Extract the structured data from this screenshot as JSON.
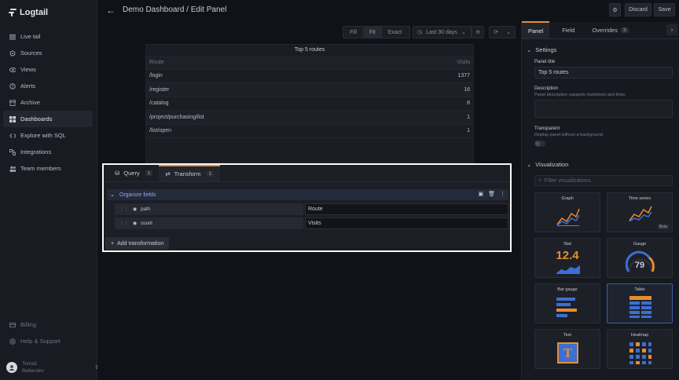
{
  "app": {
    "name": "Logtail"
  },
  "sidebar": {
    "items": [
      {
        "label": "Live tail",
        "icon": "list-icon"
      },
      {
        "label": "Sources",
        "icon": "sources-icon"
      },
      {
        "label": "Views",
        "icon": "eye-icon"
      },
      {
        "label": "Alerts",
        "icon": "alert-icon"
      },
      {
        "label": "Archive",
        "icon": "archive-icon"
      },
      {
        "label": "Dashboards",
        "icon": "dashboard-icon",
        "active": true
      },
      {
        "label": "Explore with SQL",
        "icon": "code-icon"
      },
      {
        "label": "Integrations",
        "icon": "integrations-icon"
      },
      {
        "label": "Team members",
        "icon": "team-icon"
      }
    ],
    "bottom": [
      {
        "label": "Billing",
        "icon": "billing-icon"
      },
      {
        "label": "Help & Support",
        "icon": "help-icon"
      }
    ],
    "user": {
      "name": "Tomáš",
      "team": "Betterdev"
    }
  },
  "header": {
    "title": "Demo Dashboard / Edit Panel",
    "discard_label": "Discard",
    "save_label": "Save"
  },
  "toolbar": {
    "fill_label": "Fill",
    "fit_label": "Fit",
    "exact_label": "Exact",
    "time_range": "Last 30 days"
  },
  "preview": {
    "title": "Top 5 routes",
    "columns": [
      "Route",
      "Visits"
    ],
    "rows": [
      [
        "/login",
        "1377"
      ],
      [
        "/register",
        "16"
      ],
      [
        "/catalog",
        "8"
      ],
      [
        "/project/purchasing/list",
        "1"
      ],
      [
        "/list/open",
        "1"
      ]
    ]
  },
  "editor": {
    "tabs": [
      {
        "label": "Query",
        "count": "1"
      },
      {
        "label": "Transform",
        "count": "1",
        "active": true
      }
    ],
    "transformation": {
      "title": "Organize fields",
      "fields": [
        {
          "name": "path",
          "rename": "Route"
        },
        {
          "name": "count",
          "rename": "Visits"
        }
      ]
    },
    "add_label": "Add transformation"
  },
  "options": {
    "tabs": [
      {
        "label": "Panel",
        "active": true
      },
      {
        "label": "Field"
      },
      {
        "label": "Overrides",
        "count": "3"
      }
    ],
    "settings_label": "Settings",
    "panel_title_label": "Panel title",
    "panel_title_value": "Top 5 routes",
    "description_label": "Description",
    "description_hint": "Panel description supports markdown and links.",
    "transparent_label": "Transparent",
    "transparent_hint": "Display panel without a background.",
    "visualization_label": "Visualization",
    "search_placeholder": "Filter visualizations",
    "visualizations": [
      {
        "name": "Graph"
      },
      {
        "name": "Time series",
        "badge": "Beta"
      },
      {
        "name": "Stat",
        "sample": "12.4"
      },
      {
        "name": "Gauge",
        "sample": "79"
      },
      {
        "name": "Bar gauge"
      },
      {
        "name": "Table",
        "selected": true
      },
      {
        "name": "Text",
        "sample": "T"
      },
      {
        "name": "Heatmap"
      }
    ]
  },
  "colors": {
    "accent": "#e58e2e",
    "blue": "#3b6fd4",
    "link": "#8aa8f0"
  }
}
